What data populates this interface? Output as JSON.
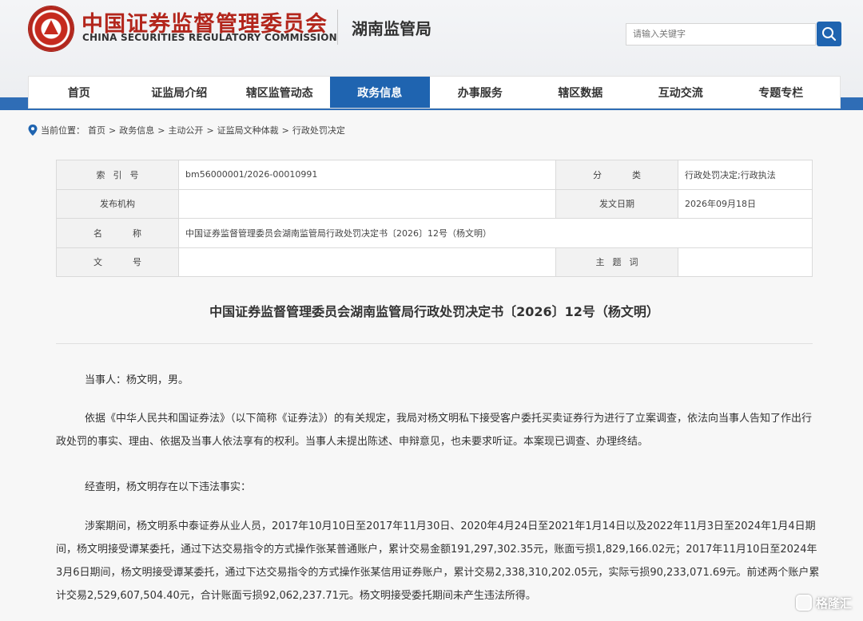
{
  "header": {
    "org_cn": "中国证券监督管理委员会",
    "org_en": "CHINA SECURITIES REGULATORY COMMISSION",
    "bureau": "湖南监管局",
    "search_placeholder": "请输入关键字",
    "logo_icon": "csrc-emblem-icon",
    "brand_color": "#b3261c",
    "accent_color": "#1f64b0"
  },
  "nav": {
    "items": [
      "首页",
      "证监局介绍",
      "辖区监管动态",
      "政务信息",
      "办事服务",
      "辖区数据",
      "互动交流",
      "专题专栏"
    ],
    "active": "政务信息"
  },
  "breadcrumb": {
    "prefix": "当前位置：",
    "items": [
      "首页",
      "政务信息",
      "主动公开",
      "证监局文种体裁",
      "行政处罚决定"
    ],
    "separator": ">"
  },
  "info": {
    "index_label": "索引号",
    "index_value": "bm56000001/2026-00010991",
    "category_label": "分类",
    "category_value": "行政处罚决定;行政执法",
    "publisher_label": "发布机构",
    "publisher_value": "",
    "date_label": "发文日期",
    "date_value": "2026年09月18日",
    "name_label": "名称",
    "name_value": "中国证券监督管理委员会湖南监管局行政处罚决定书〔2026〕12号（杨文明）",
    "docno_label": "文号",
    "docno_value": "",
    "keywords_label": "主题词",
    "keywords_value": ""
  },
  "document": {
    "title": "中国证券监督管理委员会湖南监管局行政处罚决定书〔2026〕12号（杨文明）",
    "party": "当事人：杨文明，男。",
    "para_basis": "依据《中华人民共和国证券法》（以下简称《证券法》）的有关规定，我局对杨文明私下接受客户委托买卖证券行为进行了立案调查，依法向当事人告知了作出行政处罚的事实、理由、依据及当事人依法享有的权利。当事人未提出陈述、申辩意见，也未要求听证。本案现已调查、办理终结。",
    "para_found": "经查明，杨文明存在以下违法事实：",
    "para_facts": "涉案期间，杨文明系中泰证券从业人员，2017年10月10日至2017年11月30日、2020年4月24日至2021年1月14日以及2022年11月3日至2024年1月4日期间，杨文明接受谭某委托，通过下达交易指令的方式操作张某普通账户，累计交易金额191,297,302.35元，账面亏损1,829,166.02元；2017年11月10日至2024年3月6日期间，杨文明接受谭某委托，通过下达交易指令的方式操作张某信用证券账户，累计交易2,338,310,202.05元，实际亏损90,233,071.69元。前述两个账户累计交易2,529,607,504.40元，合计账面亏损92,062,237.71元。杨文明接受委托期间未产生违法所得。"
  },
  "watermark": {
    "text": "格隆汇",
    "icon": "gelonghui-logo-icon"
  }
}
